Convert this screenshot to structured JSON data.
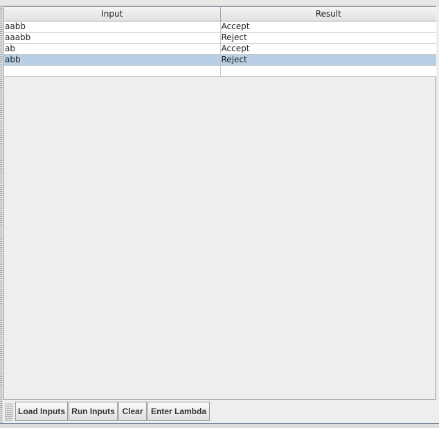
{
  "table": {
    "columns": [
      "Input",
      "Result"
    ],
    "rows": [
      {
        "input": "aabb",
        "result": "Accept"
      },
      {
        "input": "aaabb",
        "result": "Reject"
      },
      {
        "input": "ab",
        "result": "Accept"
      },
      {
        "input": "abb",
        "result": "Reject",
        "selected": true
      },
      {
        "input": "",
        "result": ""
      }
    ]
  },
  "toolbar": {
    "load_inputs": "Load Inputs",
    "run_inputs": "Run Inputs",
    "clear": "Clear",
    "enter_lambda": "Enter Lambda"
  },
  "colors": {
    "selection": "#b8cfe5",
    "background": "#eeeeee"
  }
}
